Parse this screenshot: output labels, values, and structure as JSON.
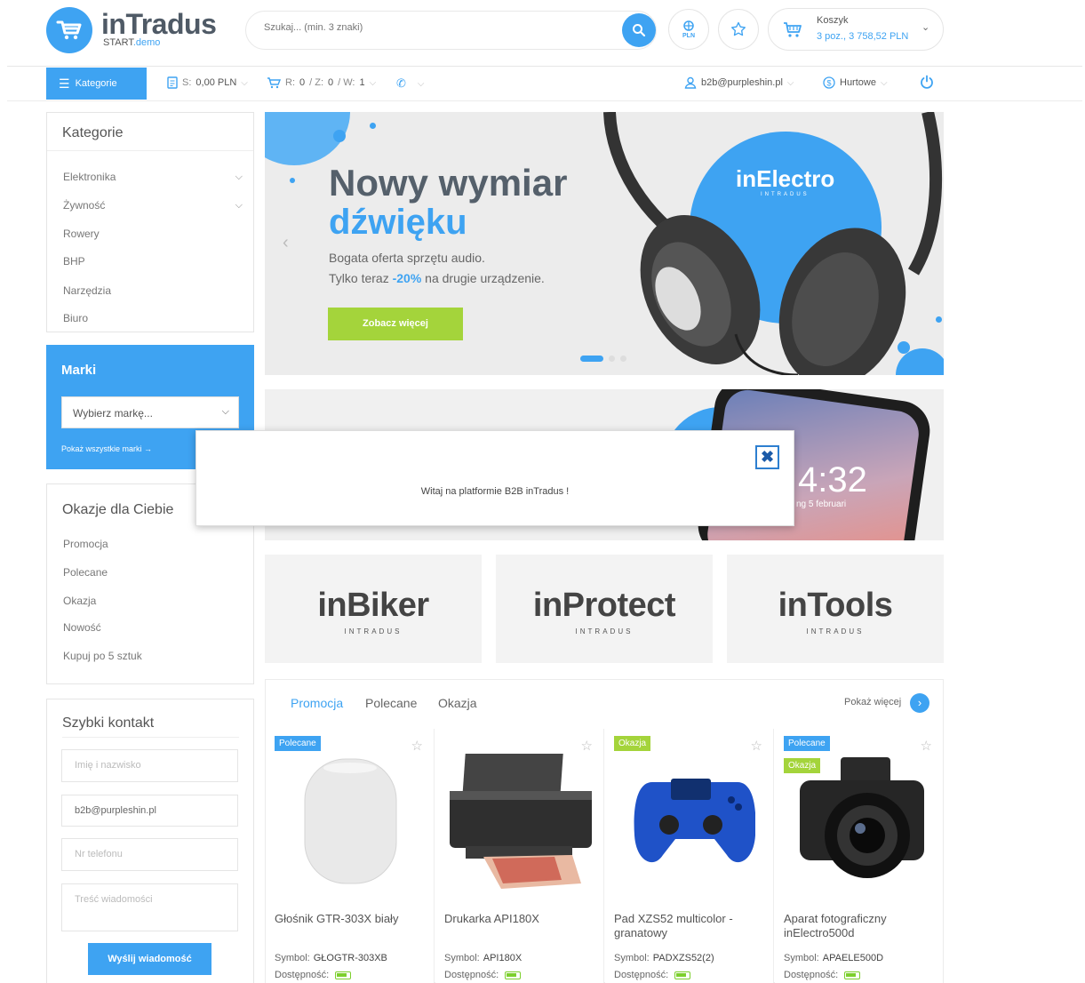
{
  "brand": {
    "name": "inTradus",
    "sub_prefix": "START",
    "sub_suffix": ".demo"
  },
  "search": {
    "placeholder": "Szukaj... (min. 3 znaki)"
  },
  "currency": {
    "label": "PLN"
  },
  "cart": {
    "title": "Koszyk",
    "summary": "3 poz., 3 758,52 PLN"
  },
  "nav": {
    "categories_label": "Kategorie",
    "balance_prefix": "S:",
    "balance_value": "0,00 PLN",
    "cart_prefix_r": "R:",
    "cart_r": "0",
    "cart_prefix_z": "/ Z:",
    "cart_z": "0",
    "cart_prefix_w": "/ W:",
    "cart_w": "1",
    "user_email": "b2b@purpleshin.pl",
    "price_type": "Hurtowe"
  },
  "sidebar": {
    "categories_title": "Kategorie",
    "categories": [
      "Elektronika",
      "Żywność",
      "Rowery",
      "BHP",
      "Narzędzia",
      "Biuro"
    ],
    "brands_title": "Marki",
    "brands_select": "Wybierz markę...",
    "brands_all": "Pokaż wszystkie marki",
    "deals_title": "Okazje dla Ciebie",
    "deals": [
      "Promocja",
      "Polecane",
      "Okazja",
      "Nowość",
      "Kupuj po 5 sztuk"
    ],
    "contact_title": "Szybki kontakt",
    "contact_name_placeholder": "Imię i nazwisko",
    "contact_email_value": "b2b@purpleshin.pl",
    "contact_phone_placeholder": "Nr telefonu",
    "contact_message_placeholder": "Treść wiadomości",
    "contact_send": "Wyślij wiadomość"
  },
  "banner": {
    "title_line1": "Nowy wymiar",
    "title_line2": "dźwięku",
    "text_line1": "Bogata oferta sprzętu audio.",
    "text_line2_pre": "Tylko teraz",
    "text_line2_hl": "-20%",
    "text_line2_post": "na drugie urządzenie.",
    "cta": "Zobacz więcej",
    "badge_name": "inElectro",
    "badge_sub": "INTRADUS"
  },
  "banner2": {
    "time": "4:32",
    "date": "ng 5 februari"
  },
  "modal": {
    "message": "Witaj na platformie B2B inTradus !"
  },
  "brand_tiles": [
    {
      "name": "inBiker",
      "sub": "INTRADUS"
    },
    {
      "name": "inProtect",
      "sub": "INTRADUS"
    },
    {
      "name": "inTools",
      "sub": "INTRADUS"
    }
  ],
  "products": {
    "tabs": [
      "Promocja",
      "Polecane",
      "Okazja"
    ],
    "more": "Pokaż więcej",
    "symbol_label": "Symbol:",
    "availability_label": "Dostępność:",
    "items": [
      {
        "name": "Głośnik GTR-303X biały",
        "symbol": "GŁOGTR-303XB",
        "badges": [
          "Polecane"
        ]
      },
      {
        "name": "Drukarka API180X",
        "symbol": "API180X",
        "badges": []
      },
      {
        "name": "Pad XZS52 multicolor - granatowy",
        "symbol": "PADXZS52(2)",
        "badges": [
          "Okazja"
        ]
      },
      {
        "name": "Aparat fotograficzny inElectro500d",
        "symbol": "APAELE500D",
        "badges": [
          "Polecane",
          "Okazja"
        ]
      }
    ]
  },
  "colors": {
    "accent": "#3ea3f2",
    "green": "#a4d43b",
    "text": "#555555"
  }
}
